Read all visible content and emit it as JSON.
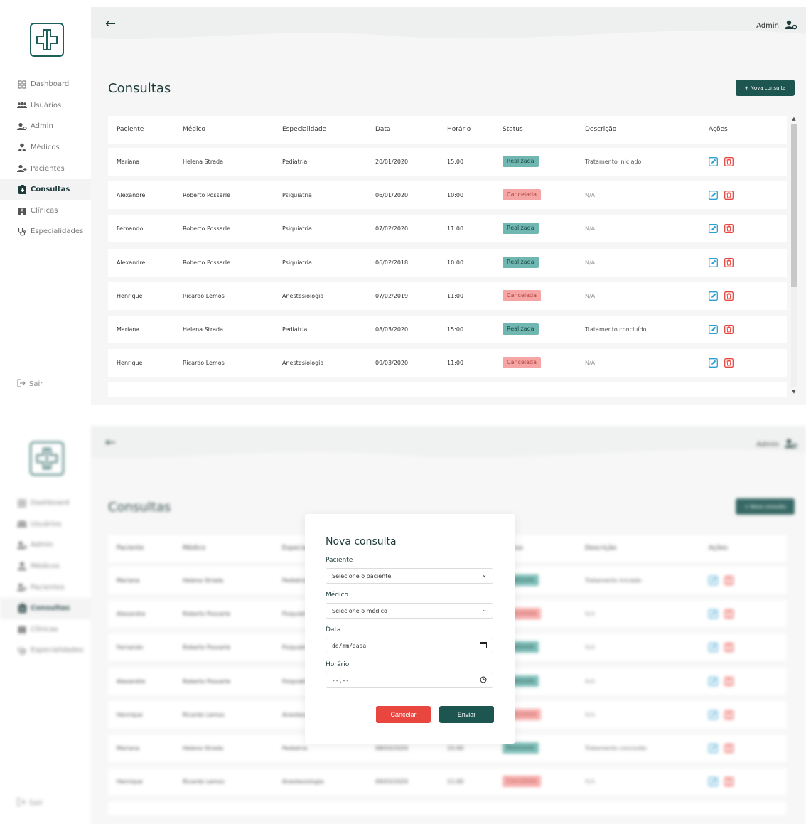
{
  "header": {
    "back_icon": "arrow-left-icon",
    "user_label": "Admin",
    "user_icon": "user-gear-icon"
  },
  "sidebar": {
    "logo_icon": "medical-cross-icon",
    "items": [
      {
        "label": "Dashboard",
        "icon": "grid-icon"
      },
      {
        "label": "Usuários",
        "icon": "users-icon"
      },
      {
        "label": "Admin",
        "icon": "user-gear-icon"
      },
      {
        "label": "Médicos",
        "icon": "doctor-icon"
      },
      {
        "label": "Pacientes",
        "icon": "user-plus-icon"
      },
      {
        "label": "Consultas",
        "icon": "clipboard-icon"
      },
      {
        "label": "Clínicas",
        "icon": "hospital-icon"
      },
      {
        "label": "Especialidades",
        "icon": "stethoscope-icon"
      }
    ],
    "active_item": "Consultas",
    "logout_label": "Sair"
  },
  "page": {
    "title": "Consultas",
    "new_button_label": "+ Nova consulta"
  },
  "table": {
    "columns": [
      "Paciente",
      "Médico",
      "Especialidade",
      "Data",
      "Horário",
      "Status",
      "Descrição",
      "Ações"
    ],
    "rows": [
      {
        "paciente": "Mariana",
        "medico": "Helena Strada",
        "especialidade": "Pediatria",
        "data": "20/01/2020",
        "horario": "15:00",
        "status": "Realizada",
        "descricao": "Tratamento iniciado"
      },
      {
        "paciente": "Alexandre",
        "medico": "Roberto Possarle",
        "especialidade": "Psiquiatria",
        "data": "06/01/2020",
        "horario": "10:00",
        "status": "Cancelada",
        "descricao": "N/A"
      },
      {
        "paciente": "Fernando",
        "medico": "Roberto Possarle",
        "especialidade": "Psiquiatria",
        "data": "07/02/2020",
        "horario": "11:00",
        "status": "Realizada",
        "descricao": "N/A"
      },
      {
        "paciente": "Alexandre",
        "medico": "Roberto Possarle",
        "especialidade": "Psiquiatria",
        "data": "06/02/2018",
        "horario": "10:00",
        "status": "Realizada",
        "descricao": "N/A"
      },
      {
        "paciente": "Henrique",
        "medico": "Ricardo Lemos",
        "especialidade": "Anestesiologia",
        "data": "07/02/2019",
        "horario": "11:00",
        "status": "Cancelada",
        "descricao": "N/A"
      },
      {
        "paciente": "Mariana",
        "medico": "Helena Strada",
        "especialidade": "Pediatria",
        "data": "08/03/2020",
        "horario": "15:00",
        "status": "Realizada",
        "descricao": "Tratamento concluído"
      },
      {
        "paciente": "Henrique",
        "medico": "Ricardo Lemos",
        "especialidade": "Anestesiologia",
        "data": "09/03/2020",
        "horario": "11:00",
        "status": "Cancelada",
        "descricao": "N/A"
      }
    ],
    "action_icons": [
      "edit-icon",
      "trash-icon"
    ]
  },
  "modal": {
    "title": "Nova consulta",
    "fields": {
      "paciente": {
        "label": "Paciente",
        "placeholder": "Selecione o paciente"
      },
      "medico": {
        "label": "Médico",
        "placeholder": "Selecione o médico"
      },
      "data": {
        "label": "Data",
        "placeholder": "dd/mm/aaaa"
      },
      "horario": {
        "label": "Horário",
        "placeholder": "--:--"
      }
    },
    "cancel_label": "Cancelar",
    "submit_label": "Enviar"
  },
  "colors": {
    "brand": "#1d5551",
    "status_realizada": "#6fb7b0",
    "status_cancelada": "#f5a5a3",
    "cancel_button": "#e8463f"
  }
}
